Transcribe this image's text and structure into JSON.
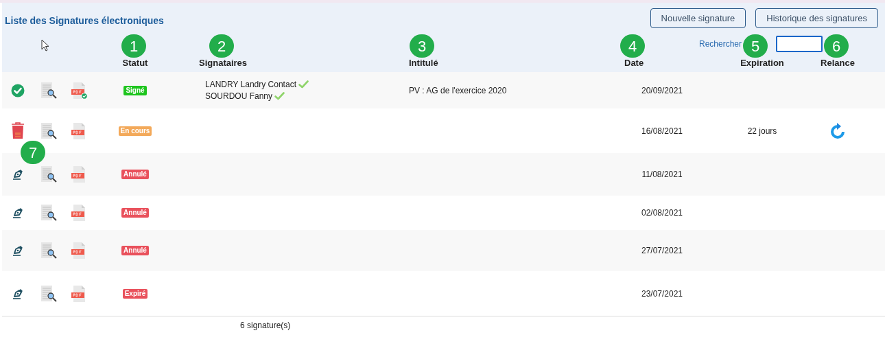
{
  "title": "Liste des Signatures électroniques",
  "buttons": [
    "Nouvelle signature",
    "Historique des signatures"
  ],
  "search": {
    "label": "Rechercher"
  },
  "columns": [
    "Statut",
    "Signataires",
    "Intitulé",
    "Date",
    "Expiration",
    "Relance"
  ],
  "rows": [
    {
      "kind": "signed",
      "pdf_signed": true,
      "status": {
        "label": "Signé",
        "color": "#1ec51e"
      },
      "signatories": [
        {
          "name": "LANDRY Landry Contact",
          "signed": true
        },
        {
          "name": "SOURDOU Fanny",
          "signed": true
        }
      ],
      "title": "PV : AG de l'exercice 2020",
      "date": "20/09/2021",
      "relaunch": false
    },
    {
      "kind": "deletable",
      "pdf_signed": false,
      "status": {
        "label": "En cours",
        "color": "#f3a95a"
      },
      "date": "16/08/2021",
      "expiration": "22 jours",
      "relaunch": true
    },
    {
      "kind": "signable",
      "pdf_signed": false,
      "status": {
        "label": "Annulé",
        "color": "#e9515c"
      },
      "date": "11/08/2021",
      "relaunch": false
    },
    {
      "kind": "signable",
      "pdf_signed": false,
      "status": {
        "label": "Annulé",
        "color": "#e9515c"
      },
      "date": "02/08/2021",
      "relaunch": false
    },
    {
      "kind": "signable",
      "pdf_signed": false,
      "status": {
        "label": "Annulé",
        "color": "#e9515c"
      },
      "date": "27/07/2021",
      "relaunch": false
    },
    {
      "kind": "signable",
      "pdf_signed": false,
      "status": {
        "label": "Expiré",
        "color": "#e9515c"
      },
      "date": "23/07/2021",
      "relaunch": false
    }
  ],
  "footer": "6 signature(s)",
  "callouts": [
    "1",
    "2",
    "3",
    "4",
    "5",
    "6",
    "7"
  ]
}
